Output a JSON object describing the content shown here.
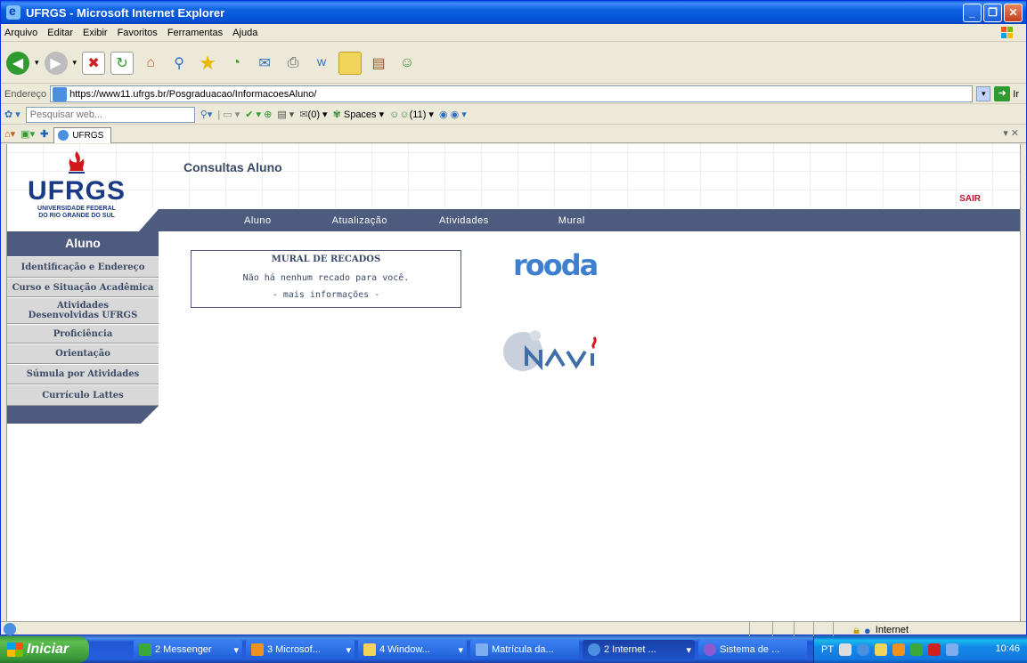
{
  "window": {
    "title": "UFRGS - Microsoft Internet Explorer"
  },
  "menu": [
    "Arquivo",
    "Editar",
    "Exibir",
    "Favoritos",
    "Ferramentas",
    "Ajuda"
  ],
  "address": {
    "label": "Endereço",
    "url": "https://www11.ufrgs.br/Posgraduacao/InformacoesAluno/",
    "go_label": "Ir"
  },
  "searchbar": {
    "placeholder": "Pesquisar web...",
    "mail_count": "(0)",
    "spaces_label": "Spaces",
    "contacts_count": "(11)"
  },
  "tab": {
    "label": "UFRGS"
  },
  "page": {
    "logo": {
      "name": "UFRGS",
      "sub1": "UNIVERSIDADE FEDERAL",
      "sub2": "DO RIO GRANDE DO SUL"
    },
    "heading": "Consultas Aluno",
    "logout": "SAIR",
    "nav": [
      "Aluno",
      "Atualização",
      "Atividades",
      "Mural"
    ],
    "sidebar": {
      "title": "Aluno",
      "items": [
        "Identificação e Endereço",
        "Curso e Situação Acadêmica",
        "Atividades Desenvolvidas UFRGS",
        "Proficiência",
        "Orientação",
        "Súmula por Atividades",
        "Currículo Lattes"
      ]
    },
    "mural": {
      "title": "MURAL DE RECADOS",
      "message": "Não há nenhum recado para você.",
      "more": "- mais informações -"
    },
    "rooda": "rooda",
    "navi": "NAVi"
  },
  "status": {
    "zone": "Internet"
  },
  "taskbar": {
    "start": "Iniciar",
    "tasks": [
      "2 Messenger",
      "3 Microsof...",
      "4 Window...",
      "Matrícula da...",
      "2 Internet ...",
      "Sistema de ..."
    ],
    "lang": "PT",
    "clock": "10:46"
  },
  "colors": {
    "nav": "#4c5b7e",
    "title_blue": "#0a5ee0",
    "logout_red": "#c8102e"
  }
}
